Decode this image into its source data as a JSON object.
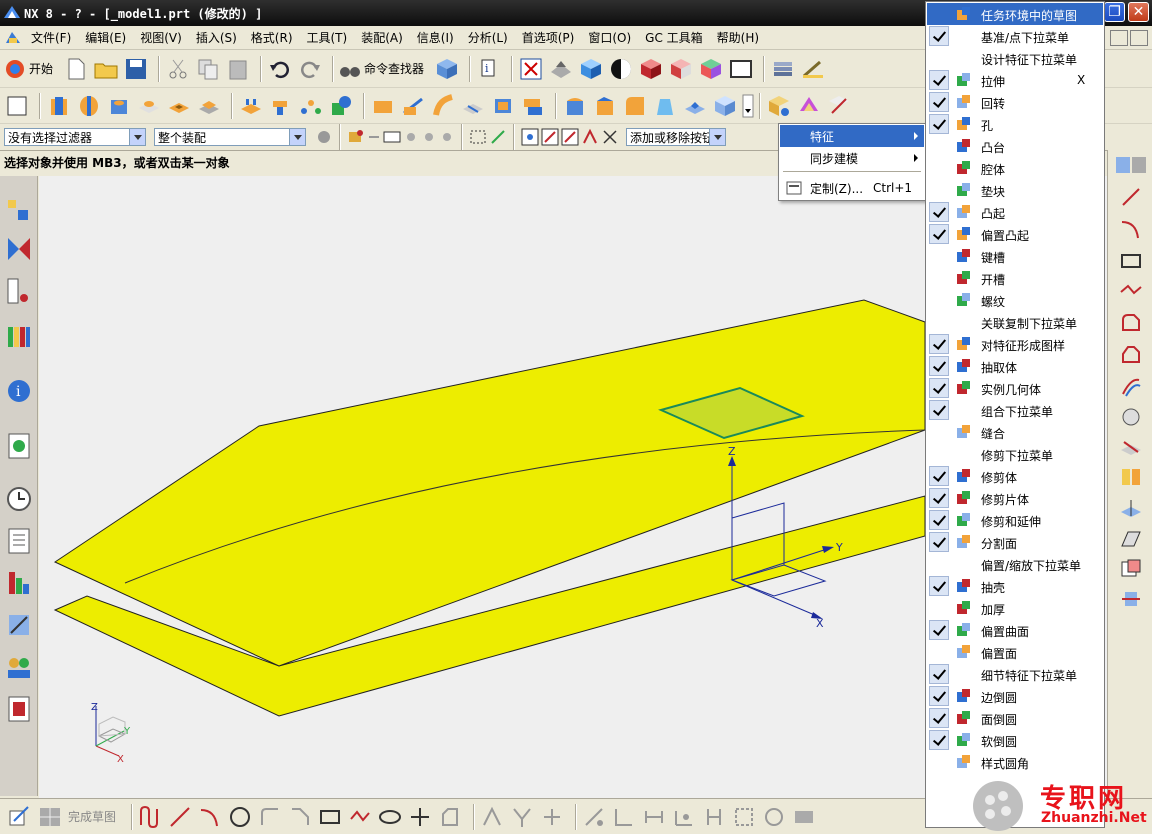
{
  "window": {
    "title": "NX 8 - ? - [_model1.prt  (修改的) ]"
  },
  "menubar": {
    "items": [
      "文件(F)",
      "编辑(E)",
      "视图(V)",
      "插入(S)",
      "格式(R)",
      "工具(T)",
      "装配(A)",
      "信息(I)",
      "分析(L)",
      "首选项(P)",
      "窗口(O)",
      "GC 工具箱",
      "帮助(H)"
    ]
  },
  "toolbar": {
    "start_label": "开始",
    "command_finder_label": "命令查找器",
    "add_remove_label": "添加或移除按钮"
  },
  "filters": {
    "type_filter": "没有选择过滤器",
    "scope_filter": "整个装配"
  },
  "cue_line": "选择对象并使用 MB3，或者双击某一对象",
  "cascade_menu": {
    "items": [
      {
        "label": "特征",
        "submenu": true,
        "active": true
      },
      {
        "label": "同步建模",
        "submenu": true,
        "active": false
      },
      {
        "label": "定制(Z)...",
        "shortcut": "Ctrl+1",
        "submenu": false,
        "active": false
      }
    ]
  },
  "feature_menu": {
    "items": [
      {
        "label": "任务环境中的草图",
        "checked": false,
        "icon": "sketch-icon",
        "highlight": true
      },
      {
        "label": "基准/点下拉菜单",
        "checked": true,
        "icon": ""
      },
      {
        "label": "设计特征下拉菜单",
        "checked": false,
        "icon": ""
      },
      {
        "label": "拉伸",
        "checked": true,
        "icon": "extrude-icon",
        "shortcut": "X"
      },
      {
        "label": "回转",
        "checked": true,
        "icon": "revolve-icon"
      },
      {
        "label": "孔",
        "checked": true,
        "icon": "hole-icon"
      },
      {
        "label": "凸台",
        "checked": false,
        "icon": "boss-icon"
      },
      {
        "label": "腔体",
        "checked": false,
        "icon": "pocket-icon"
      },
      {
        "label": "垫块",
        "checked": false,
        "icon": "pad-icon"
      },
      {
        "label": "凸起",
        "checked": true,
        "icon": "emboss-icon"
      },
      {
        "label": "偏置凸起",
        "checked": true,
        "icon": "offset-emboss-icon"
      },
      {
        "label": "键槽",
        "checked": false,
        "icon": "slot-icon"
      },
      {
        "label": "开槽",
        "checked": false,
        "icon": "groove-icon"
      },
      {
        "label": "螺纹",
        "checked": false,
        "icon": "thread-icon"
      },
      {
        "label": "关联复制下拉菜单",
        "checked": false,
        "icon": ""
      },
      {
        "label": "对特征形成图样",
        "checked": true,
        "icon": "pattern-feature-icon"
      },
      {
        "label": "抽取体",
        "checked": true,
        "icon": "extract-body-icon"
      },
      {
        "label": "实例几何体",
        "checked": true,
        "icon": "instance-geometry-icon"
      },
      {
        "label": "组合下拉菜单",
        "checked": true,
        "icon": ""
      },
      {
        "label": "缝合",
        "checked": false,
        "icon": "sew-icon"
      },
      {
        "label": "修剪下拉菜单",
        "checked": false,
        "icon": ""
      },
      {
        "label": "修剪体",
        "checked": true,
        "icon": "trim-body-icon"
      },
      {
        "label": "修剪片体",
        "checked": true,
        "icon": "trim-sheet-icon"
      },
      {
        "label": "修剪和延伸",
        "checked": true,
        "icon": "trim-extend-icon"
      },
      {
        "label": "分割面",
        "checked": true,
        "icon": "divide-face-icon"
      },
      {
        "label": "偏置/缩放下拉菜单",
        "checked": false,
        "icon": ""
      },
      {
        "label": "抽壳",
        "checked": true,
        "icon": "shell-icon"
      },
      {
        "label": "加厚",
        "checked": false,
        "icon": "thicken-icon"
      },
      {
        "label": "偏置曲面",
        "checked": true,
        "icon": "offset-surface-icon"
      },
      {
        "label": "偏置面",
        "checked": false,
        "icon": "offset-face-icon"
      },
      {
        "label": "细节特征下拉菜单",
        "checked": true,
        "icon": ""
      },
      {
        "label": "边倒圆",
        "checked": true,
        "icon": "edge-blend-icon"
      },
      {
        "label": "面倒圆",
        "checked": true,
        "icon": "face-blend-icon"
      },
      {
        "label": "软倒圆",
        "checked": true,
        "icon": "soft-blend-icon"
      },
      {
        "label": "样式圆角",
        "checked": false,
        "icon": "styled-blend-icon"
      }
    ]
  },
  "viewport": {
    "axis_labels": {
      "z": "Z",
      "y": "Y",
      "x": "X"
    },
    "triad_labels": {
      "z": "Z",
      "y": "Y",
      "x": "X"
    },
    "surface_color": "#eded00",
    "sketch_plane_color": "#c8dc28",
    "background": "#efefef"
  },
  "bottombar": {
    "finish_sketch_label": "完成草图"
  },
  "watermark": {
    "cn": "专职网",
    "url": "Zhuanzhi.Net"
  }
}
